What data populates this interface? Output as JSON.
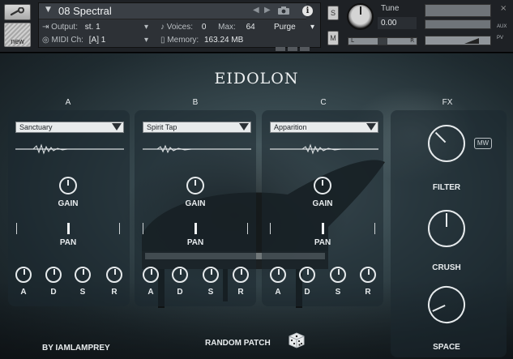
{
  "header": {
    "instrument_name": "08 Spectral",
    "output_label": "Output:",
    "output_value": "st. 1",
    "midi_label": "MIDI Ch:",
    "midi_value": "[A]  1",
    "voices_label": "Voices:",
    "voices_value": "0",
    "max_label": "Max:",
    "max_value": "64",
    "memory_label": "Memory:",
    "memory_value": "163.24 MB",
    "purge_label": "Purge",
    "new_label": "new",
    "solo_label": "S",
    "mute_label": "M",
    "tune_label": "Tune",
    "tune_value": "0.00",
    "pan_left": "L",
    "pan_right": "R",
    "aux_label": "AUX",
    "pv_label": "PV",
    "close_label": "×"
  },
  "main": {
    "title": "EIDOLON",
    "columns": [
      {
        "label": "A",
        "preset": "Sanctuary",
        "gain_label": "GAIN",
        "pan_label": "PAN",
        "adsr": [
          "A",
          "D",
          "S",
          "R"
        ]
      },
      {
        "label": "B",
        "preset": "Spirit Tap",
        "gain_label": "GAIN",
        "pan_label": "PAN",
        "adsr": [
          "A",
          "D",
          "S",
          "R"
        ]
      },
      {
        "label": "C",
        "preset": "Apparition",
        "gain_label": "GAIN",
        "pan_label": "PAN",
        "adsr": [
          "A",
          "D",
          "S",
          "R"
        ]
      }
    ],
    "fx": {
      "label": "FX",
      "mw_label": "MW",
      "filter_label": "FILTER",
      "crush_label": "CRUSH",
      "space_label": "SPACE"
    },
    "credit": "BY IAMLAMPREY",
    "random_label": "RANDOM PATCH"
  },
  "colors": {
    "header_bg": "#1e2125",
    "panel_bg": "#1c2830",
    "accent_text": "#e8ecee"
  }
}
